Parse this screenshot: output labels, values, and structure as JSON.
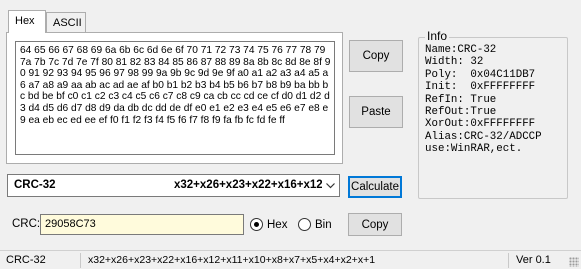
{
  "tabs": [
    {
      "label": "Hex",
      "active": true
    },
    {
      "label": "ASCII",
      "active": false
    }
  ],
  "hex_input": "64 65 66 67 68 69 6a 6b 6c 6d 6e 6f 70 71 72 73 74 75 76 77 78 79 7a 7b 7c 7d 7e 7f 80 81 82 83 84 85 86 87 88 89 8a 8b 8c 8d 8e 8f 90 91 92 93 94 95 96 97 98 99 9a 9b 9c 9d 9e 9f a0 a1 a2 a3 a4 a5 a6 a7 a8 a9 aa ab ac ad ae af b0 b1 b2 b3 b4 b5 b6 b7 b8 b9 ba bb bc bd be bf c0 c1 c2 c3 c4 c5 c6 c7 c8 c9 ca cb cc cd ce cf d0 d1 d2 d3 d4 d5 d6 d7 d8 d9 da db dc dd de df e0 e1 e2 e3 e4 e5 e6 e7 e8 e9 ea eb ec ed ee ef f0 f1 f2 f3 f4 f5 f6 f7 f8 f9 fa fb fc fd fe ff",
  "buttons": {
    "copy_input": "Copy",
    "paste": "Paste",
    "calculate": "Calculate",
    "copy_crc": "Copy"
  },
  "info": {
    "title": "Info",
    "lines": [
      "Name:CRC-32",
      "Width: 32",
      "Poly:  0x04C11DB7",
      "Init:  0xFFFFFFFF",
      "RefIn: True",
      "RefOut:True",
      "XorOut:0xFFFFFFFF",
      "Alias:CRC-32/ADCCP",
      "use:WinRAR,ect."
    ]
  },
  "algorithm": {
    "name": "CRC-32",
    "polynomial": "x32+x26+x23+x22+x16+x12+x11+x10+x8+x7+x5+x4+x2+x+1"
  },
  "crc": {
    "label": "CRC:",
    "value": "29058C73",
    "format_options": [
      {
        "label": "Hex",
        "selected": true
      },
      {
        "label": "Bin",
        "selected": false
      }
    ]
  },
  "status": {
    "algorithm": "CRC-32",
    "polynomial": "x32+x26+x23+x22+x16+x12+x11+x10+x8+x7+x5+x4+x2+x+1",
    "version": "Ver 0.1"
  },
  "icons": {
    "dropdown": "chevron-down-icon",
    "grip": "resize-grip-icon"
  }
}
